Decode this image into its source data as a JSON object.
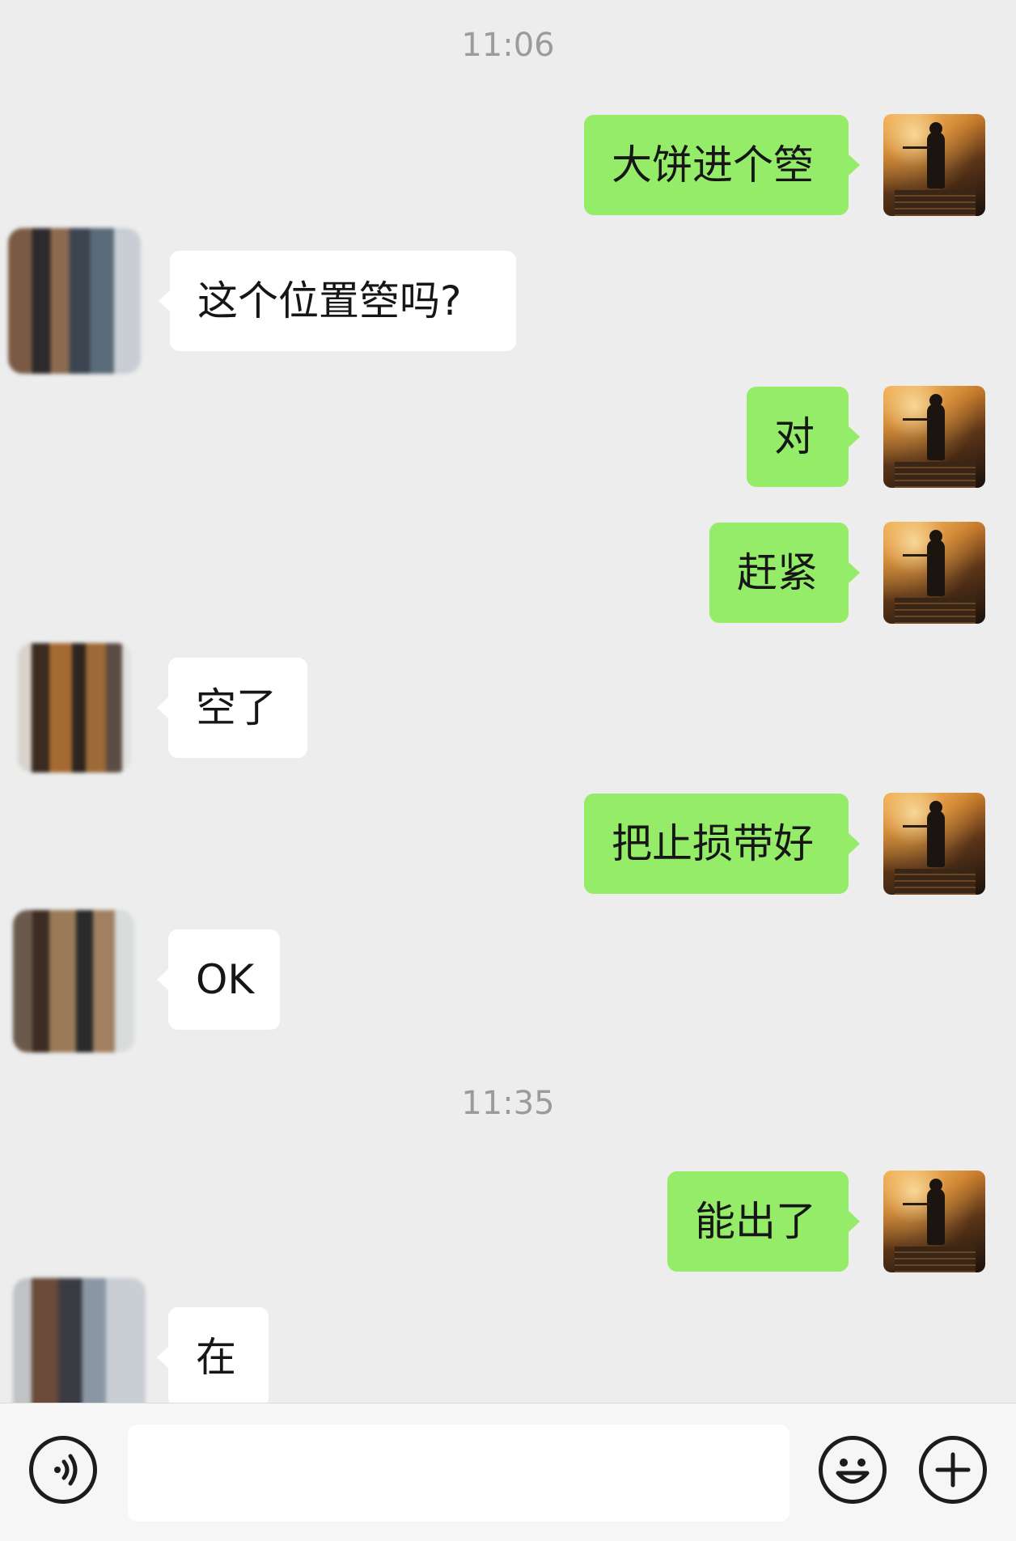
{
  "chat": {
    "timestamps": [
      "11:06",
      "11:35"
    ],
    "messages": [
      {
        "sender": "me",
        "text": "大饼进个箜"
      },
      {
        "sender": "other",
        "text": "这个位置箜吗?"
      },
      {
        "sender": "me",
        "text": "对"
      },
      {
        "sender": "me",
        "text": "赶紧"
      },
      {
        "sender": "other",
        "text": "空了"
      },
      {
        "sender": "me",
        "text": "把止损带好"
      },
      {
        "sender": "other",
        "text": "OK"
      },
      {
        "sender": "me",
        "text": "能出了"
      },
      {
        "sender": "other",
        "text": "在"
      }
    ]
  },
  "input_bar": {
    "voice_icon": "voice-icon",
    "emoji_icon": "emoji-icon",
    "plus_icon": "plus-icon",
    "input_value": ""
  },
  "colors": {
    "background": "#ededed",
    "my_bubble": "#95ec69",
    "their_bubble": "#ffffff",
    "timestamp": "#9b9b9b"
  }
}
